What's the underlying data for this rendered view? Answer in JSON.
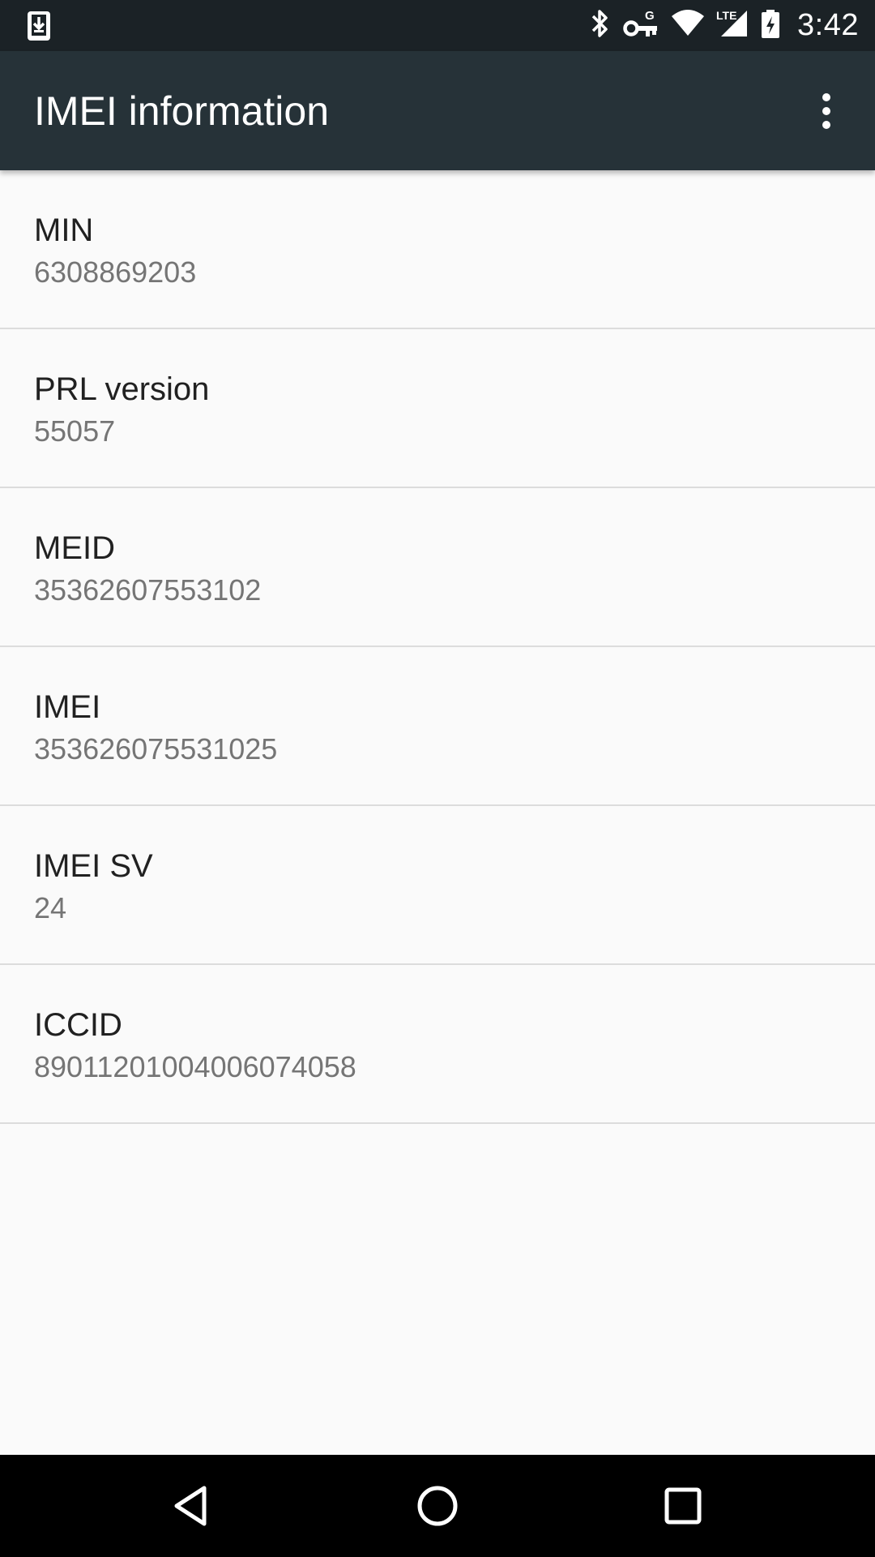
{
  "status_bar": {
    "time": "3:42",
    "network_label": "LTE",
    "vpn_label": "G",
    "icons": [
      "download-notification-icon",
      "bluetooth-icon",
      "vpn-key-icon",
      "wifi-icon",
      "lte-signal-icon",
      "battery-charging-icon"
    ]
  },
  "app_bar": {
    "title": "IMEI information",
    "menu_icon": "more-vert-icon"
  },
  "items": [
    {
      "title": "MIN",
      "value": "6308869203"
    },
    {
      "title": "PRL version",
      "value": "55057"
    },
    {
      "title": "MEID",
      "value": "35362607553102"
    },
    {
      "title": "IMEI",
      "value": "353626075531025"
    },
    {
      "title": "IMEI SV",
      "value": "24"
    },
    {
      "title": "ICCID",
      "value": "89011201004006074058"
    }
  ],
  "nav_bar": {
    "icons": [
      "back-icon",
      "home-icon",
      "recents-icon"
    ]
  },
  "colors": {
    "status_bar": "#1b2226",
    "app_bar": "#263238",
    "background": "#fafafa",
    "divider": "#dcdcdc",
    "title_text": "#212121",
    "secondary_text": "#757575",
    "nav_bar": "#000000"
  }
}
